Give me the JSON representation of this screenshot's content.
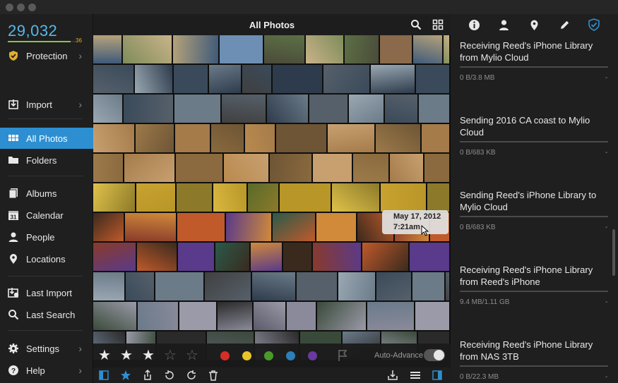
{
  "window": {
    "controls": [
      "close",
      "minimize",
      "zoom"
    ]
  },
  "sidebar": {
    "photo_count": "29,032",
    "protection_count": "36",
    "protection_progress": 0.93,
    "items": [
      {
        "label": "Protection",
        "icon": "shield-check-icon"
      },
      {
        "label": "Import",
        "icon": "import-icon"
      },
      {
        "label": "All Photos",
        "icon": "grid-icon"
      },
      {
        "label": "Folders",
        "icon": "folder-icon"
      },
      {
        "label": "Albums",
        "icon": "albums-icon"
      },
      {
        "label": "Calendar",
        "icon": "calendar-icon"
      },
      {
        "label": "People",
        "icon": "person-icon"
      },
      {
        "label": "Locations",
        "icon": "location-pin-icon"
      },
      {
        "label": "Last Import",
        "icon": "last-import-icon"
      },
      {
        "label": "Last Search",
        "icon": "search-icon"
      },
      {
        "label": "Settings",
        "icon": "gear-icon"
      },
      {
        "label": "Help",
        "icon": "help-icon"
      }
    ]
  },
  "center": {
    "title": "All Photos",
    "tooltip": {
      "date": "May 17, 2012",
      "time": "7:21am"
    },
    "rating": {
      "filled": 3,
      "total": 5
    },
    "color_labels": [
      "#d62e26",
      "#e8c52a",
      "#4a9a2a",
      "#2c7fb8",
      "#6a3aa0"
    ],
    "auto_advance_label": "Auto-Advance"
  },
  "right_panel": {
    "tabs": [
      "info-icon",
      "person-icon",
      "location-pin-icon",
      "pencil-icon",
      "shield-icon"
    ],
    "tasks": [
      {
        "title": "Receiving Reed's iPhone Library from Mylio Cloud",
        "size": "0 B/3.8 MB",
        "dash": "-"
      },
      {
        "title": "Sending 2016 CA coast to Mylio Cloud",
        "size": "0 B/683 KB",
        "dash": "-"
      },
      {
        "title": "Sending Reed's iPhone Library to Mylio Cloud",
        "size": "0 B/683 KB",
        "dash": "-"
      },
      {
        "title": "Receiving Reed's iPhone Library from Reed's iPhone",
        "size": "9.4 MB/1.11 GB",
        "dash": "-"
      },
      {
        "title": "Receiving Reed's iPhone Library from NAS 3TB",
        "size": "0 B/22.3 MB",
        "dash": "-"
      }
    ]
  },
  "colors": {
    "accent": "#2d8fd1",
    "count": "#58b8e8",
    "protection": "#e0b030"
  }
}
